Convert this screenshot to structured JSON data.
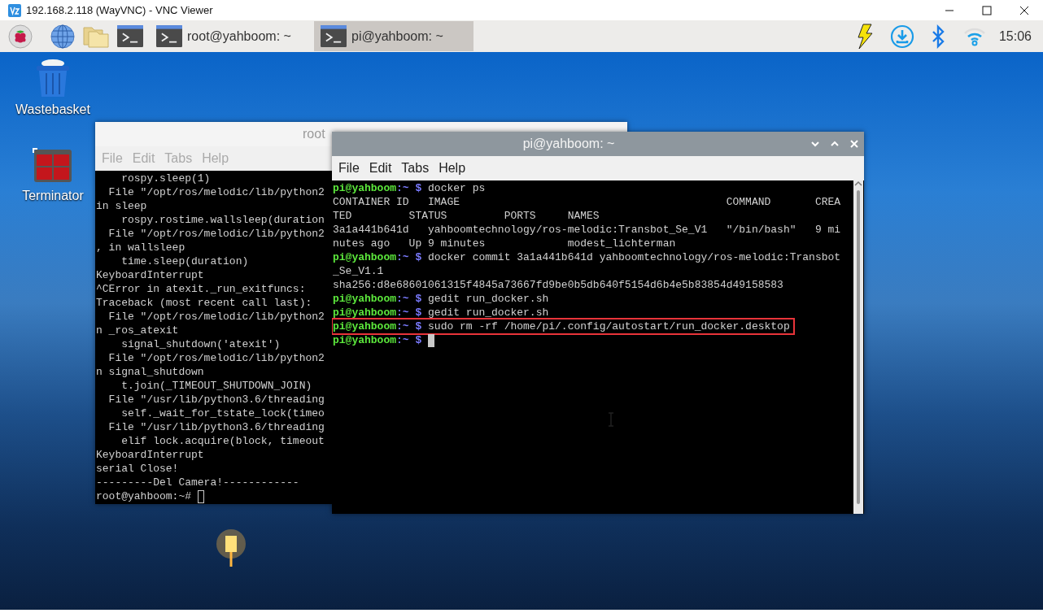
{
  "vnc_window": {
    "title": "192.168.2.118 (WayVNC) - VNC Viewer"
  },
  "taskbar": {
    "tasks": [
      {
        "label": "root@yahboom: ~",
        "selected": false
      },
      {
        "label": "pi@yahboom: ~",
        "selected": true
      }
    ],
    "clock": "15:06"
  },
  "desktop_icons": [
    {
      "label": "Wastebasket",
      "kind": "trash"
    },
    {
      "label": "Terminator",
      "kind": "terminator"
    }
  ],
  "windows": [
    {
      "title": "root",
      "active": false,
      "menu": [
        "File",
        "Edit",
        "Tabs",
        "Help"
      ],
      "lines": [
        {
          "kind": "output",
          "text": "    rospy.sleep(1)"
        },
        {
          "kind": "output",
          "text": "  File \"/opt/ros/melodic/lib/python2"
        },
        {
          "kind": "output",
          "text": "in sleep"
        },
        {
          "kind": "output",
          "text": "    rospy.rostime.wallsleep(duration"
        },
        {
          "kind": "output",
          "text": "  File \"/opt/ros/melodic/lib/python2"
        },
        {
          "kind": "output",
          "text": ", in wallsleep"
        },
        {
          "kind": "output",
          "text": "    time.sleep(duration)"
        },
        {
          "kind": "output",
          "text": "KeyboardInterrupt"
        },
        {
          "kind": "output",
          "text": "^CError in atexit._run_exitfuncs:"
        },
        {
          "kind": "output",
          "text": "Traceback (most recent call last):"
        },
        {
          "kind": "output",
          "text": "  File \"/opt/ros/melodic/lib/python2"
        },
        {
          "kind": "output",
          "text": "n _ros_atexit"
        },
        {
          "kind": "output",
          "text": "    signal_shutdown('atexit')"
        },
        {
          "kind": "output",
          "text": "  File \"/opt/ros/melodic/lib/python2"
        },
        {
          "kind": "output",
          "text": "n signal_shutdown"
        },
        {
          "kind": "output",
          "text": "    t.join(_TIMEOUT_SHUTDOWN_JOIN)"
        },
        {
          "kind": "output",
          "text": "  File \"/usr/lib/python3.6/threading"
        },
        {
          "kind": "output",
          "text": "    self._wait_for_tstate_lock(timeo"
        },
        {
          "kind": "output",
          "text": "  File \"/usr/lib/python3.6/threading"
        },
        {
          "kind": "output",
          "text": "    elif lock.acquire(block, timeout"
        },
        {
          "kind": "output",
          "text": "KeyboardInterrupt"
        },
        {
          "kind": "output",
          "text": "serial Close!"
        },
        {
          "kind": "output",
          "text": "---------Del Camera!------------"
        },
        {
          "kind": "plain_prompt",
          "text": "root@yahboom:~#",
          "cursor": true
        }
      ]
    },
    {
      "title": "pi@yahboom: ~",
      "active": true,
      "menu": [
        "File",
        "Edit",
        "Tabs",
        "Help"
      ],
      "lines": [
        {
          "kind": "prompt",
          "user": "pi@yahboom",
          "path": ":~",
          "symbol": "$",
          "command": "docker ps",
          "highlighted": false,
          "cursor": false
        },
        {
          "kind": "output",
          "text": "CONTAINER ID   IMAGE                                          COMMAND       CREA"
        },
        {
          "kind": "output",
          "text": "TED         STATUS         PORTS     NAMES"
        },
        {
          "kind": "output",
          "text": "3a1a441b641d   yahboomtechnology/ros-melodic:Transbot_Se_V1   \"/bin/bash\"   9 mi"
        },
        {
          "kind": "output",
          "text": "nutes ago   Up 9 minutes             modest_lichterman"
        },
        {
          "kind": "prompt",
          "user": "pi@yahboom",
          "path": ":~",
          "symbol": "$",
          "command": "docker commit 3a1a441b641d yahboomtechnology/ros-melodic:Transbot",
          "highlighted": false,
          "cursor": false
        },
        {
          "kind": "output",
          "text": "_Se_V1.1"
        },
        {
          "kind": "output",
          "text": "sha256:d8e68601061315f4845a73667fd9be0b5db640f5154d6b4e5b83854d49158583"
        },
        {
          "kind": "prompt",
          "user": "pi@yahboom",
          "path": ":~",
          "symbol": "$",
          "command": "gedit run_docker.sh",
          "highlighted": false,
          "cursor": false
        },
        {
          "kind": "prompt",
          "user": "pi@yahboom",
          "path": ":~",
          "symbol": "$",
          "command": "gedit run_docker.sh",
          "highlighted": false,
          "cursor": false
        },
        {
          "kind": "prompt",
          "user": "pi@yahboom",
          "path": ":~",
          "symbol": "$",
          "command": "sudo rm -rf /home/pi/.config/autostart/run_docker.desktop",
          "highlighted": true,
          "cursor": false
        },
        {
          "kind": "prompt",
          "user": "pi@yahboom",
          "path": ":~",
          "symbol": "$",
          "highlighted": false,
          "cursor": true
        }
      ]
    }
  ]
}
